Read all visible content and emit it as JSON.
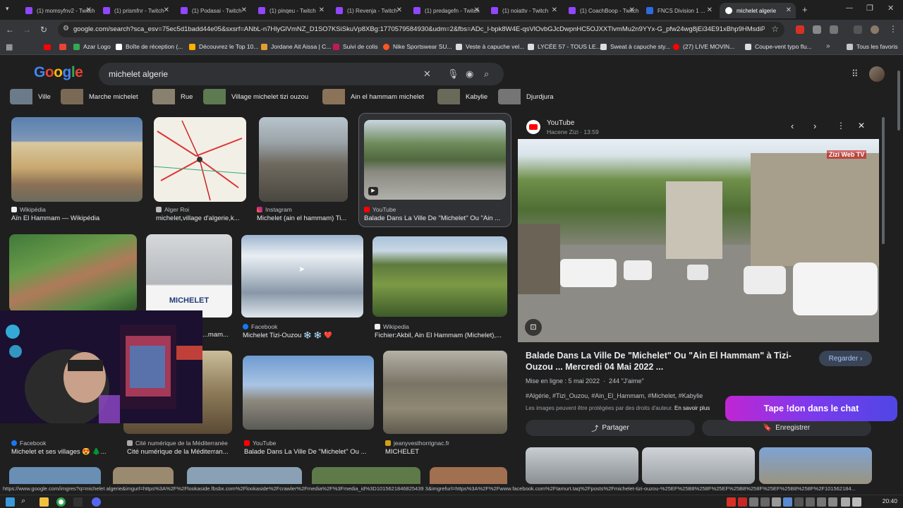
{
  "tabs": [
    {
      "label": "(1) momsyfnv2 - Twitch"
    },
    {
      "label": "(1) prismfnr - Twitch"
    },
    {
      "label": "(1) Podasai - Twitch"
    },
    {
      "label": "(1) pinqeu - Twitch"
    },
    {
      "label": "(1) Revenja - Twitch"
    },
    {
      "label": "(1) predagefn - Twitch"
    },
    {
      "label": "(1) noiattv - Twitch"
    },
    {
      "label": "(1) CoachBoop - Twitch"
    },
    {
      "label": "FNCS Division 1 ..."
    },
    {
      "label": "michelet algerie"
    }
  ],
  "address": {
    "url": "google.com/search?sca_esv=75ec5d1badd44e05&sxsrf=ANbL-n7HlyGlVmNZ_D1SO7KSiSkuVp8XBg:1770579584930&udm=2&fbs=ADc_l-bpk8W4E-qsVlOvbGJcDwpnHC5OJXXTlvmMu2n9YYx-G_pfw24wg8jEi34E91xBhp9HMsdiPSn3Aed4t..."
  },
  "bookmarks": [
    {
      "label": "Azar Logo"
    },
    {
      "label": "Boîte de réception (..."
    },
    {
      "label": "Découvrez le Top 10..."
    },
    {
      "label": "Jordane Ait Aissa | C..."
    },
    {
      "label": "Suivi de colis"
    },
    {
      "label": "Nike Sportswear SU..."
    },
    {
      "label": "Veste à capuche vel..."
    },
    {
      "label": "LYCÉE 57 - TOUS LE..."
    },
    {
      "label": "Sweat à capuche sty..."
    },
    {
      "label": "(27) LIVE MOVIN..."
    },
    {
      "label": "Coupe-vent typo flu..."
    },
    {
      "label": "Tous les favoris"
    }
  ],
  "google": {
    "logo": "Google",
    "query": "michelet algerie"
  },
  "chips": [
    {
      "label": "Ville"
    },
    {
      "label": "Marche michelet"
    },
    {
      "label": "Rue"
    },
    {
      "label": "Village michelet tizi ouzou"
    },
    {
      "label": "Ain el hammam michelet"
    },
    {
      "label": "Kabylie"
    },
    {
      "label": "Djurdjura"
    }
  ],
  "results": {
    "r1": {
      "source": "Wikipédia",
      "title": "Aïn El Hammam — Wikipédia"
    },
    "r2": {
      "source": "Alger Roi",
      "title": "michelet,village d'algerie,k..."
    },
    "r3": {
      "source": "Instagram",
      "title": "Michelet (ain el hammam) Ti..."
    },
    "r4": {
      "source": "YouTube",
      "title": "Balade Dans La Ville De \"Michelet\" Ou \"Ain ..."
    },
    "r6_caption": "MICHELET",
    "r6_title": "...mam...",
    "r7": {
      "source": "Facebook",
      "title": "Michelet Tizi-Ouzou ❄️ ❄️ ❤️"
    },
    "r8": {
      "source": "Wikipedia",
      "title": "Fichier:Akbil, Ain El Hammam (Michelet),..."
    },
    "r9": {
      "source": "Facebook",
      "title": "Michelet et ses villages 😍 🌲..."
    },
    "r10": {
      "source": "Cité numérique de la Méditerranée",
      "title": "Cité numérique de la Méditerran..."
    },
    "r11": {
      "source": "YouTube",
      "title": "Balade Dans La Ville De \"Michelet\" Ou ..."
    },
    "r12": {
      "source": "jeanyvesthorrignac.fr",
      "title": "MICHELET"
    }
  },
  "panel": {
    "source": "YouTube",
    "channel": "Hacene Zizi · 13:59",
    "watermark": "Zizi Web TV",
    "title": "Balade Dans La Ville De \"Michelet\" Ou \"Ain El Hammam\" à Tizi-Ouzou ... Mercredi 04 Mai 2022 ...",
    "watch": "Regarder ›",
    "meta": "Mise en ligne : 5 mai 2022  ·  244 \"J'aime\"",
    "tags": "#Algérie, #Tizi_Ouzou, #Ain_El_Hammam, #Michelet, #Kabylie",
    "copyright": "Les images peuvent être protégées par des droits d'auteur.",
    "learn_more": "En savoir plus",
    "share": "Partager",
    "save": "Enregistrer"
  },
  "overlay": {
    "cta": "Tape !don dans le chat"
  },
  "status": {
    "url": "https://www.google.com/imgres?q=michelet algerie&imgurl=https%3A%2F%2Flookaside.fbsbx.com%2Flookaside%2Fcrawler%2Fmedia%2F%3Fmedia_id%3D1015621846825439 3&imgrefurl=https%3A%2F%2Fwww.facebook.com%2Ftamurt.taq%2Fposts%2Fmichelet-tizi-ouzou-%25EF%25B8%258F%25EF%25B8%258F%25EF%25B8%258F%2F101562184..."
  },
  "taskbar": {
    "clock": "20:40"
  },
  "colors": {
    "accent_blue": "#8ab4f8",
    "twitch_purple": "#9146ff",
    "youtube_red": "#ff0000"
  }
}
